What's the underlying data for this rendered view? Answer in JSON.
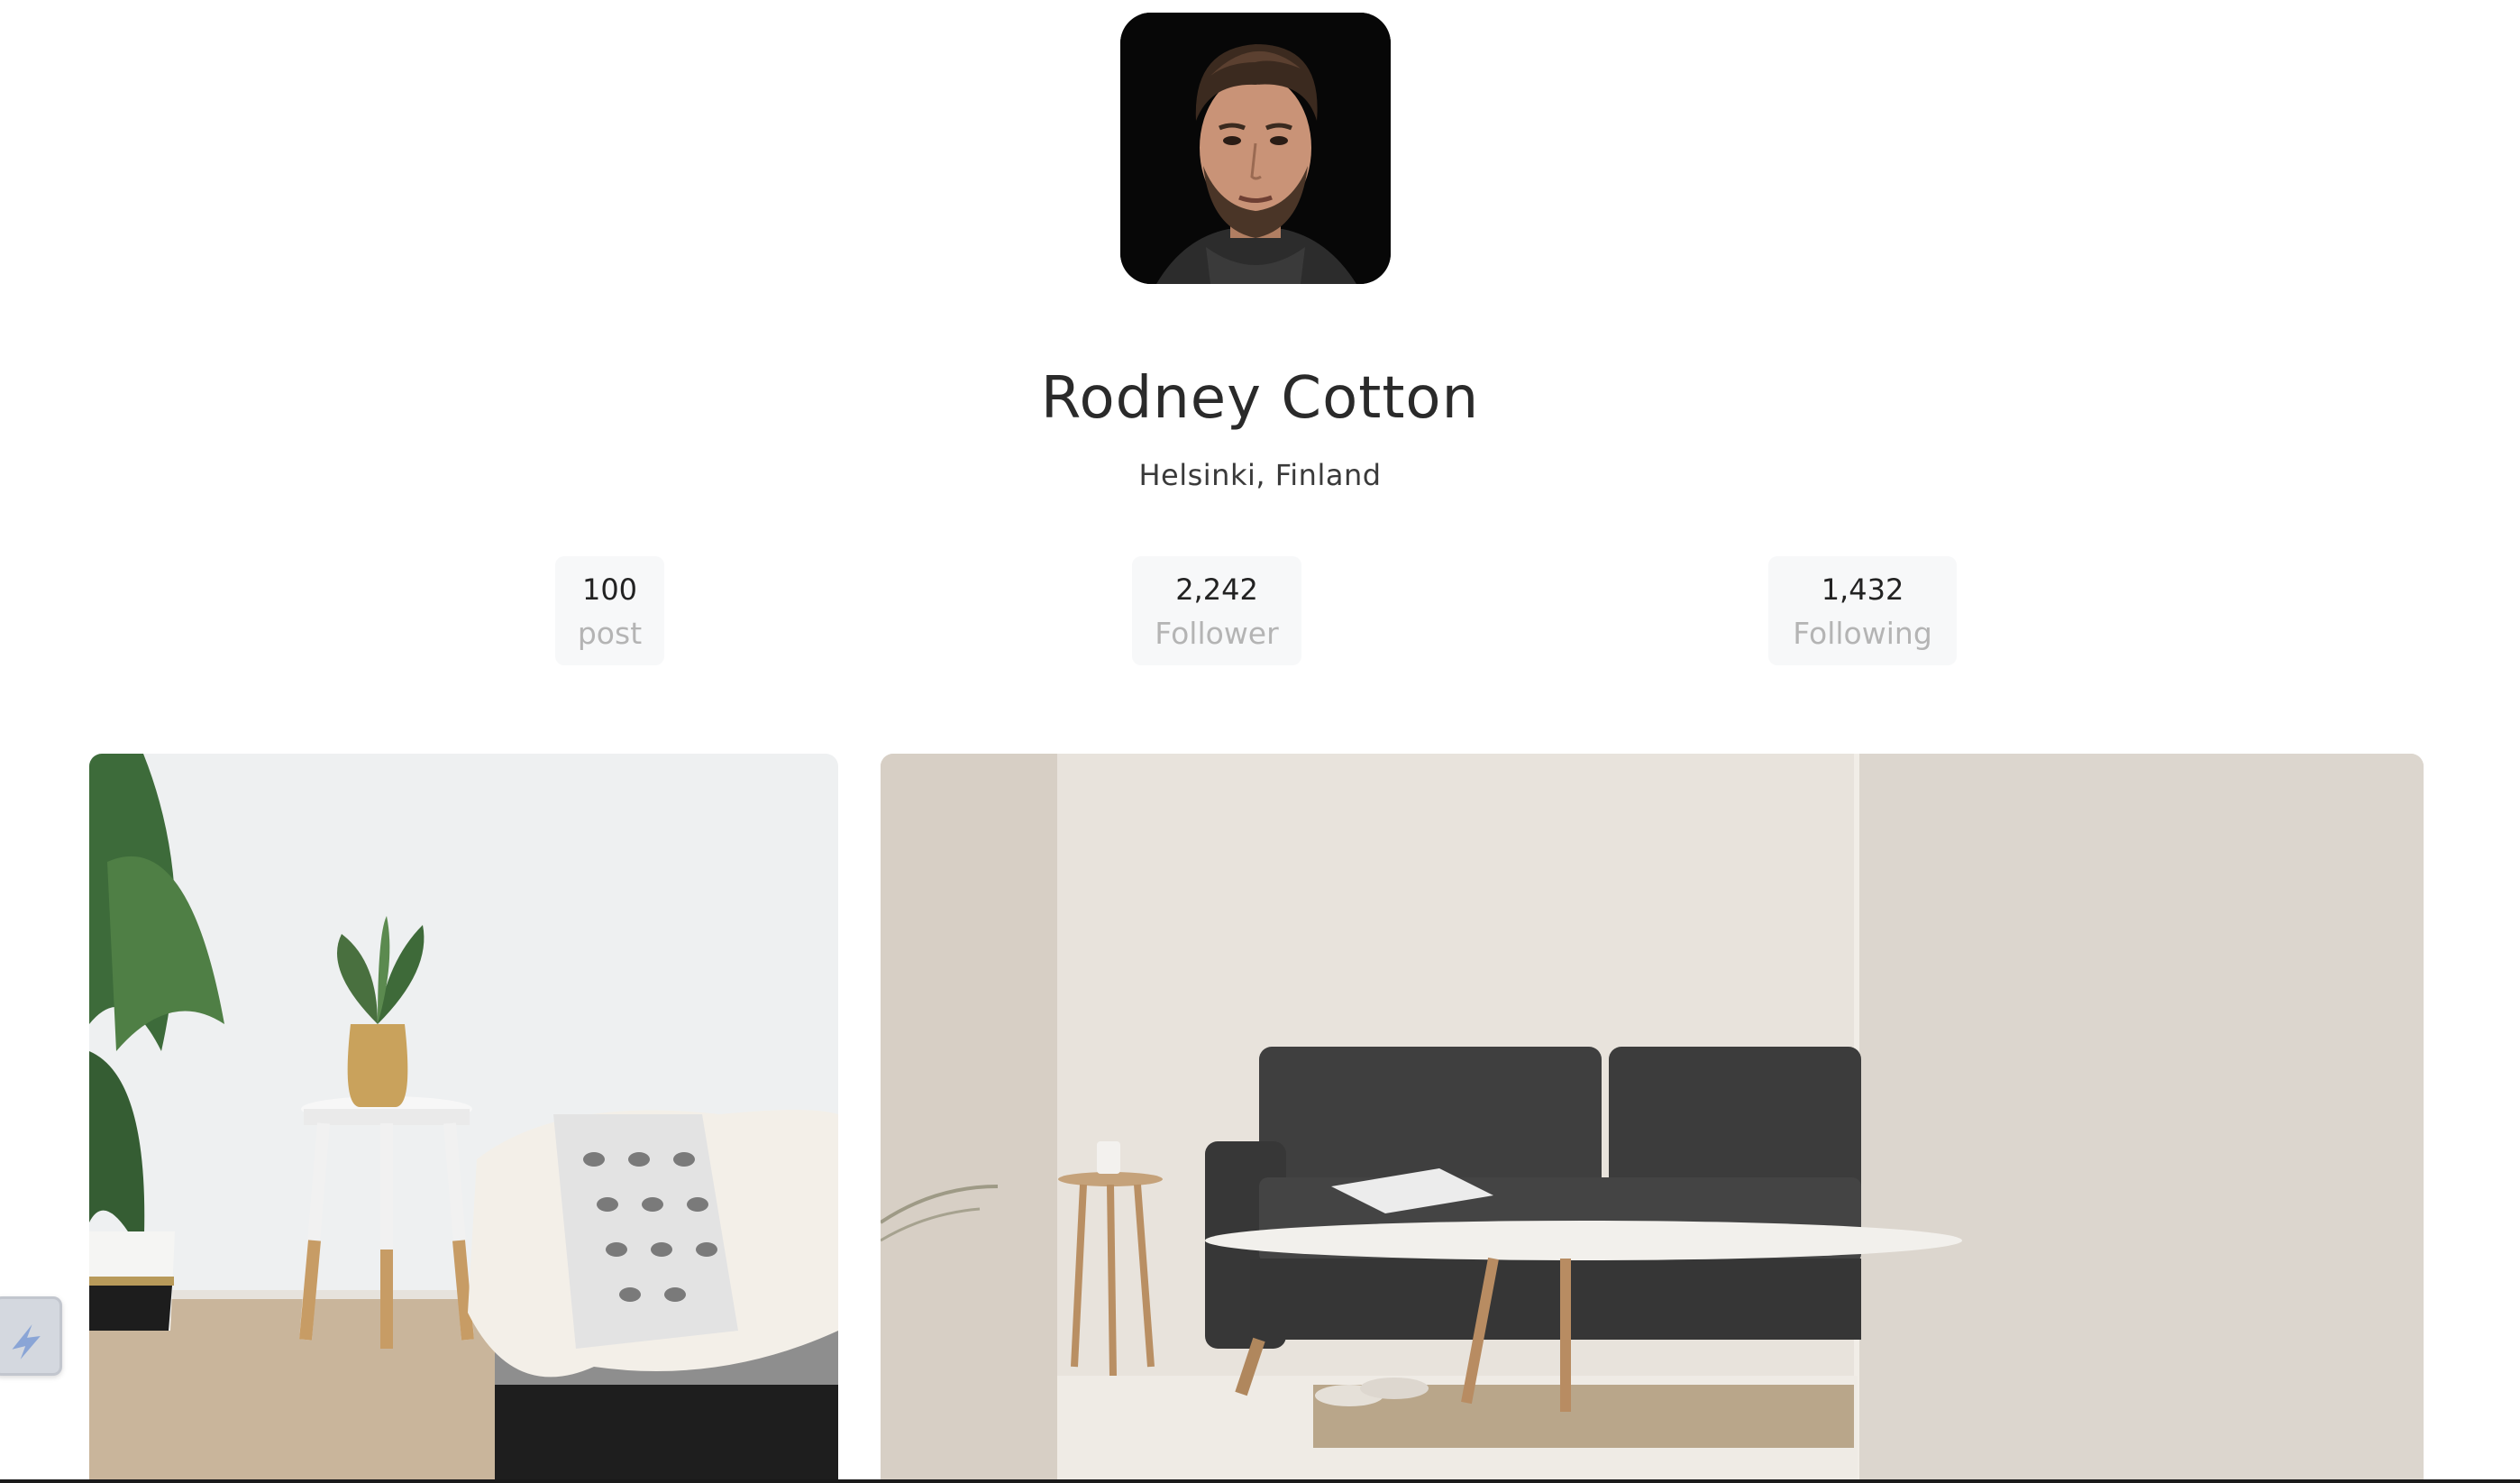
{
  "profile": {
    "name": "Rodney Cotton",
    "location": "Helsinki, Finland"
  },
  "stats": [
    {
      "value": "100",
      "label": "post"
    },
    {
      "value": "2,242",
      "label": "Follower"
    },
    {
      "value": "1,432",
      "label": "Following"
    }
  ],
  "colors": {
    "stat_bg": "#f7f8f9",
    "stat_label": "#b4b4b4",
    "text": "#2a2a2a"
  },
  "icons": {
    "floating_widget": "lightning-icon"
  }
}
